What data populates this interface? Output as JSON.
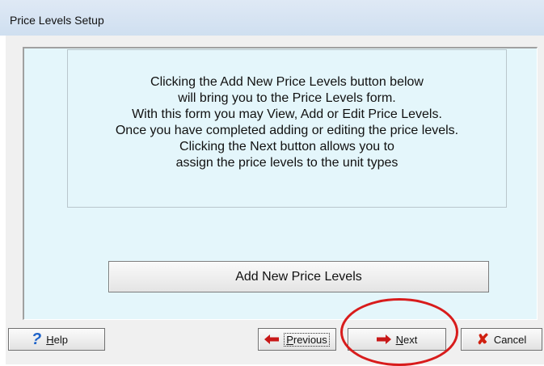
{
  "window": {
    "title": "Price Levels Setup"
  },
  "message": {
    "lines": [
      "Clicking the Add New Price Levels button below",
      "will bring you to the Price Levels form.",
      "With this form you may View, Add or Edit Price Levels.",
      "Once you have completed adding or editing the price levels.",
      "Clicking the Next button allows you to",
      "assign the price levels to the unit types"
    ]
  },
  "buttons": {
    "add_new_price_levels": "Add New Price Levels",
    "help": {
      "accel": "H",
      "rest": "elp"
    },
    "previous": {
      "accel": "P",
      "rest": "revious"
    },
    "next": {
      "accel": "N",
      "rest": "ext"
    },
    "cancel": "Cancel"
  },
  "icons": {
    "help": "help-question-icon",
    "previous": "arrow-left-icon",
    "next": "arrow-right-icon",
    "cancel": "red-x-icon"
  },
  "colors": {
    "panel_bg": "#e4f6fb",
    "arrow": "#c81818",
    "highlight_ring": "#d81c1c",
    "help_icon": "#1f63c9"
  }
}
